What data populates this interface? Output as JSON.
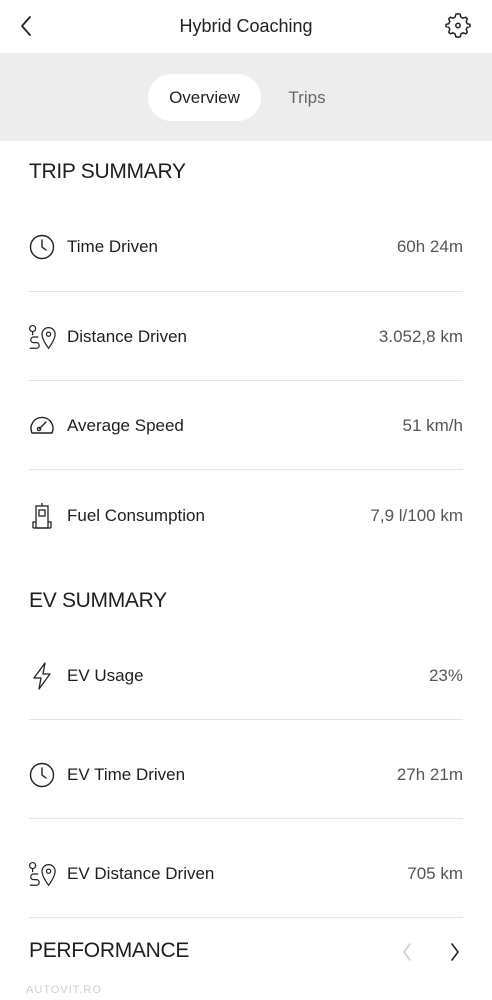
{
  "header": {
    "title": "Hybrid Coaching"
  },
  "tabs": [
    {
      "label": "Overview",
      "selected": true
    },
    {
      "label": "Trips",
      "selected": false
    }
  ],
  "trip_summary": {
    "title": "TRIP SUMMARY",
    "rows": [
      {
        "label": "Time Driven",
        "value": "60h 24m",
        "icon": "clock-icon"
      },
      {
        "label": "Distance Driven",
        "value": "3.052,8 km",
        "icon": "route-pin-icon"
      },
      {
        "label": "Average Speed",
        "value": "51 km/h",
        "icon": "speedometer-icon"
      },
      {
        "label": "Fuel Consumption",
        "value": "7,9 l/100 km",
        "icon": "fuel-pump-icon"
      }
    ]
  },
  "ev_summary": {
    "title": "EV SUMMARY",
    "rows": [
      {
        "label": "EV Usage",
        "value": "23%",
        "icon": "lightning-icon"
      },
      {
        "label": "EV Time Driven",
        "value": "27h 21m",
        "icon": "clock-icon"
      },
      {
        "label": "EV Distance Driven",
        "value": "705 km",
        "icon": "route-pin-icon"
      }
    ]
  },
  "performance": {
    "title": "PERFORMANCE"
  },
  "watermark": "AUTOVIT.RO"
}
